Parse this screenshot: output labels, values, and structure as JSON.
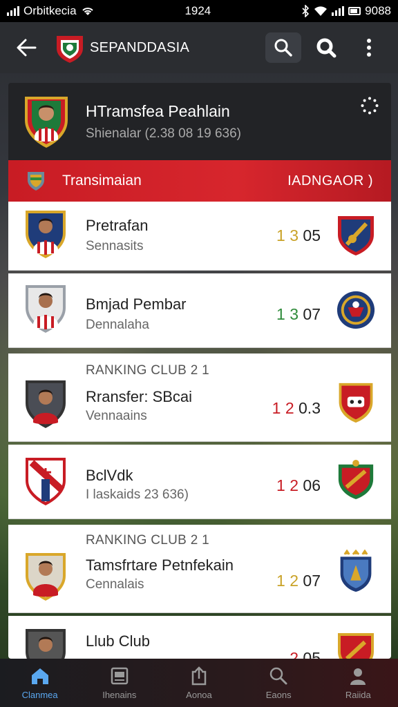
{
  "status_bar": {
    "carrier": "Orbitkecia",
    "time": "1924",
    "battery_text": "9088"
  },
  "app_bar": {
    "title": "SEPANDDASIA",
    "icons": [
      "back-arrow-icon",
      "search-icon",
      "search-bold-icon",
      "more-vert-icon"
    ]
  },
  "header": {
    "title": "HTramsfea Peahlain",
    "subtitle": "Shienalar (2.38 08 19 636)"
  },
  "section_bar": {
    "label": "Transimaian",
    "right_label": "IADNGAOR )"
  },
  "rows": [
    {
      "name": "Pretrafan",
      "sub": "Sennasits",
      "score_a": "1",
      "score_b": "3",
      "score_c": "05",
      "accent": "gold"
    },
    {
      "name": "Bmjad Pembar",
      "sub": "Dennalaha",
      "score_a": "1",
      "score_b": "3",
      "score_c": "07",
      "accent": "green"
    },
    {
      "rank": "RANKING CLUB 2 1",
      "name": "Rransfer: SBcai",
      "sub": "Vennaains",
      "score_a": "1",
      "score_b": "2",
      "score_c": "0.3",
      "accent": "red"
    },
    {
      "name": "BclVdk",
      "sub": "I laskaids 23 636)",
      "score_a": "1",
      "score_b": "2",
      "score_c": "06",
      "accent": "red"
    },
    {
      "rank": "RANKING CLUB 2 1",
      "name": "Tamsfrtare Petnfekain",
      "sub": "Cennalais",
      "score_a": "1",
      "score_b": "2",
      "score_c": "07",
      "accent": "gold"
    },
    {
      "name": "Llub Club",
      "sub": "",
      "score_a": "2",
      "score_b": "",
      "score_c": "05",
      "accent": "red"
    }
  ],
  "bottom_nav": [
    {
      "label": "Clanmea",
      "icon": "home-icon",
      "active": true
    },
    {
      "label": "Ihenains",
      "icon": "gallery-icon",
      "active": false
    },
    {
      "label": "Aonoa",
      "icon": "share-icon",
      "active": false
    },
    {
      "label": "Eaons",
      "icon": "search-icon",
      "active": false
    },
    {
      "label": "Raiida",
      "icon": "profile-icon",
      "active": false
    }
  ],
  "colors": {
    "accent_red": "#c81c24",
    "gold": "#c9a227",
    "green": "#2e8b3a",
    "active_nav": "#5aa8f0"
  }
}
